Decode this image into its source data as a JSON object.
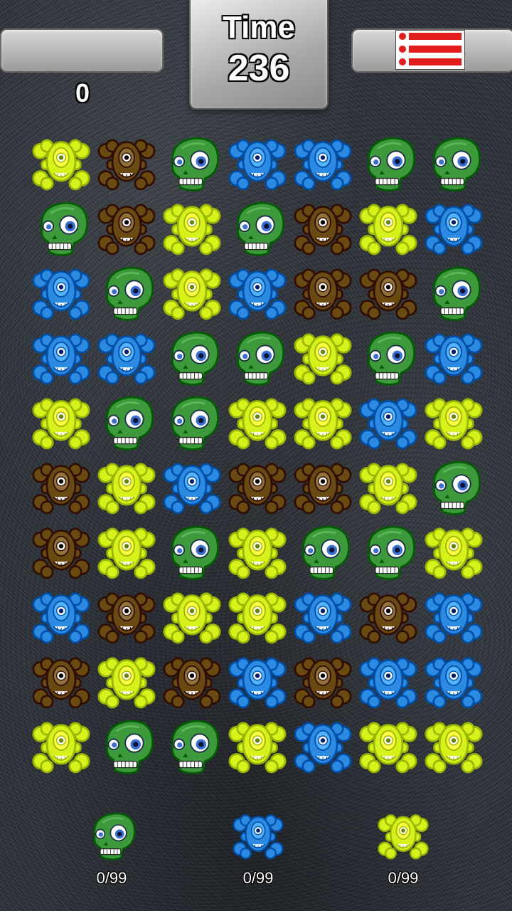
{
  "hud": {
    "time_label": "Time",
    "time_value": "236",
    "score": "0",
    "menu_icon": "hamburger-list-icon"
  },
  "colors": {
    "yellow": "#d6f21a",
    "brown": "#6b4a12",
    "green": "#3c9a3a",
    "blue": "#2b8be3",
    "menu_red": "#e21b1b"
  },
  "board": {
    "rows": 10,
    "cols": 7,
    "grid": [
      [
        "yellow-crossbones",
        "brown-crossbones",
        "green-skull",
        "blue-crossbones",
        "blue-crossbones",
        "green-skull",
        "green-skull"
      ],
      [
        "green-skull",
        "brown-crossbones",
        "yellow-crossbones",
        "green-skull",
        "brown-crossbones",
        "yellow-crossbones",
        "blue-crossbones"
      ],
      [
        "blue-crossbones",
        "green-skull",
        "yellow-crossbones",
        "blue-crossbones",
        "brown-crossbones",
        "brown-crossbones",
        "green-skull"
      ],
      [
        "blue-crossbones",
        "blue-crossbones",
        "green-skull",
        "green-skull",
        "yellow-crossbones",
        "green-skull",
        "blue-crossbones"
      ],
      [
        "yellow-crossbones",
        "green-skull",
        "green-skull",
        "yellow-crossbones",
        "yellow-crossbones",
        "blue-crossbones",
        "yellow-crossbones"
      ],
      [
        "brown-crossbones",
        "yellow-crossbones",
        "blue-crossbones",
        "brown-crossbones",
        "brown-crossbones",
        "yellow-crossbones",
        "green-skull"
      ],
      [
        "brown-crossbones",
        "yellow-crossbones",
        "green-skull",
        "yellow-crossbones",
        "green-skull",
        "green-skull",
        "yellow-crossbones"
      ],
      [
        "blue-crossbones",
        "brown-crossbones",
        "yellow-crossbones",
        "yellow-crossbones",
        "blue-crossbones",
        "brown-crossbones",
        "blue-crossbones"
      ],
      [
        "brown-crossbones",
        "yellow-crossbones",
        "brown-crossbones",
        "blue-crossbones",
        "brown-crossbones",
        "blue-crossbones",
        "blue-crossbones"
      ],
      [
        "yellow-crossbones",
        "green-skull",
        "green-skull",
        "yellow-crossbones",
        "blue-crossbones",
        "yellow-crossbones",
        "yellow-crossbones"
      ]
    ]
  },
  "goals": [
    {
      "piece": "green-skull",
      "count": "0/99"
    },
    {
      "piece": "blue-crossbones",
      "count": "0/99"
    },
    {
      "piece": "yellow-crossbones",
      "count": "0/99"
    }
  ]
}
